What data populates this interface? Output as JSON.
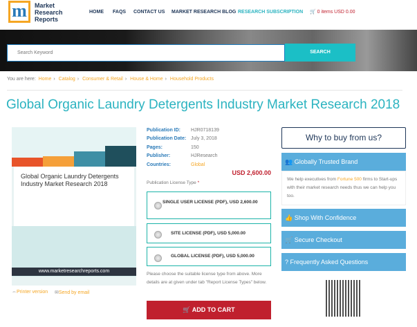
{
  "header": {
    "logo_text": "Market Research Reports",
    "logo_mark": "m",
    "nav": [
      "HOME",
      "FAQS",
      "CONTACT US",
      "MARKET RESEARCH BLOG",
      "RESEARCH SUBSCRIPTION"
    ],
    "cart": "0 items USD 0.00"
  },
  "search": {
    "placeholder": "Search Keyword",
    "button": "SEARCH"
  },
  "breadcrumb": {
    "prefix": "You are here:",
    "items": [
      "Home",
      "Catalog",
      "Consumer & Retail",
      "House & Home",
      "Household Products"
    ]
  },
  "page_title": "Global Organic Laundry Detergents Industry Market Research 2018",
  "cover": {
    "title": "Global Organic Laundry Detergents Industry Market Research 2018",
    "url": "www.marketresearchreports.com"
  },
  "links": {
    "printer": "Printer version",
    "email": "Send by email"
  },
  "details": [
    {
      "label": "Publication ID:",
      "value": "HJR0718139"
    },
    {
      "label": "Publication Date:",
      "value": "July 3, 2018"
    },
    {
      "label": "Pages:",
      "value": "150"
    },
    {
      "label": "Publisher:",
      "value": "HJResearch"
    },
    {
      "label": "Countries:",
      "value": "Global"
    }
  ],
  "price": "USD 2,600.00",
  "license": {
    "label": "Publication License Type",
    "required": "*",
    "options": [
      "SINGLE USER LICENSE (PDF), USD 2,600.00",
      "SITE LICENSE (PDF), USD 5,000.00",
      "GLOBAL LICENSE (PDF), USD 5,000.00"
    ],
    "note": "Please choose the suitable license type from above. More details are at given under tab \"Report License Types\" below."
  },
  "add_to_cart": "ADD TO CART",
  "sidebar": {
    "why": "Why to buy from us?",
    "trusted": "Globally Trusted Brand",
    "trusted_text_1": "We help executives from",
    "fortune": "Fortune 500",
    "trusted_text_2": "firms to Start-ups with their market research needs thus we can help you too.",
    "shop": "Shop With Confidence",
    "secure": "Secure Checkout",
    "faq": "Frequently Asked Questions"
  },
  "colors": {
    "accent": "#2bb3c0",
    "link": "#f5a623",
    "price": "#c0202e",
    "side": "#5aaddc"
  }
}
